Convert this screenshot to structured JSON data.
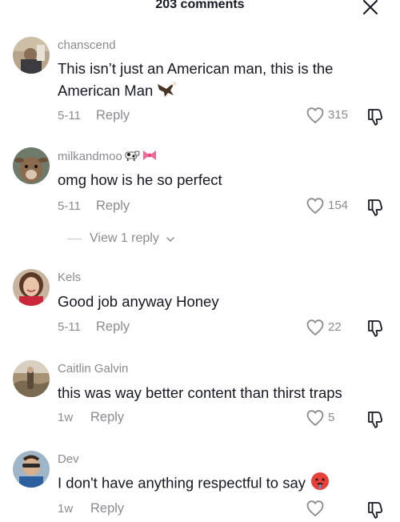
{
  "header": {
    "title": "203 comments",
    "close_icon": "close-icon"
  },
  "comments": [
    {
      "username": "chanscend",
      "text_line1": "This isn’t just an American man, this is the",
      "text_line2": "American Man",
      "emoji": "eagle-icon",
      "date": "5-11",
      "reply_label": "Reply",
      "likes": "315"
    },
    {
      "username": "milkandmoo",
      "username_emojis": [
        "cow-icon",
        "bow-icon"
      ],
      "text": "omg how is he so perfect",
      "date": "5-11",
      "reply_label": "Reply",
      "likes": "154",
      "view_replies": "View 1 reply"
    },
    {
      "username": "Kels",
      "text": "Good job anyway Honey",
      "date": "5-11",
      "reply_label": "Reply",
      "likes": "22"
    },
    {
      "username": "Caitlin Galvin",
      "text": "this was way better content than thirst traps",
      "date": "1w",
      "reply_label": "Reply",
      "likes": "5"
    },
    {
      "username": "Dev",
      "text": "I don't have anything respectful to say",
      "emoji": "hot-face-icon",
      "date": "1w",
      "reply_label": "Reply",
      "likes": ""
    }
  ],
  "colors": {
    "text": "#161823",
    "secondary": "#8a8b91",
    "background": "#ffffff"
  }
}
